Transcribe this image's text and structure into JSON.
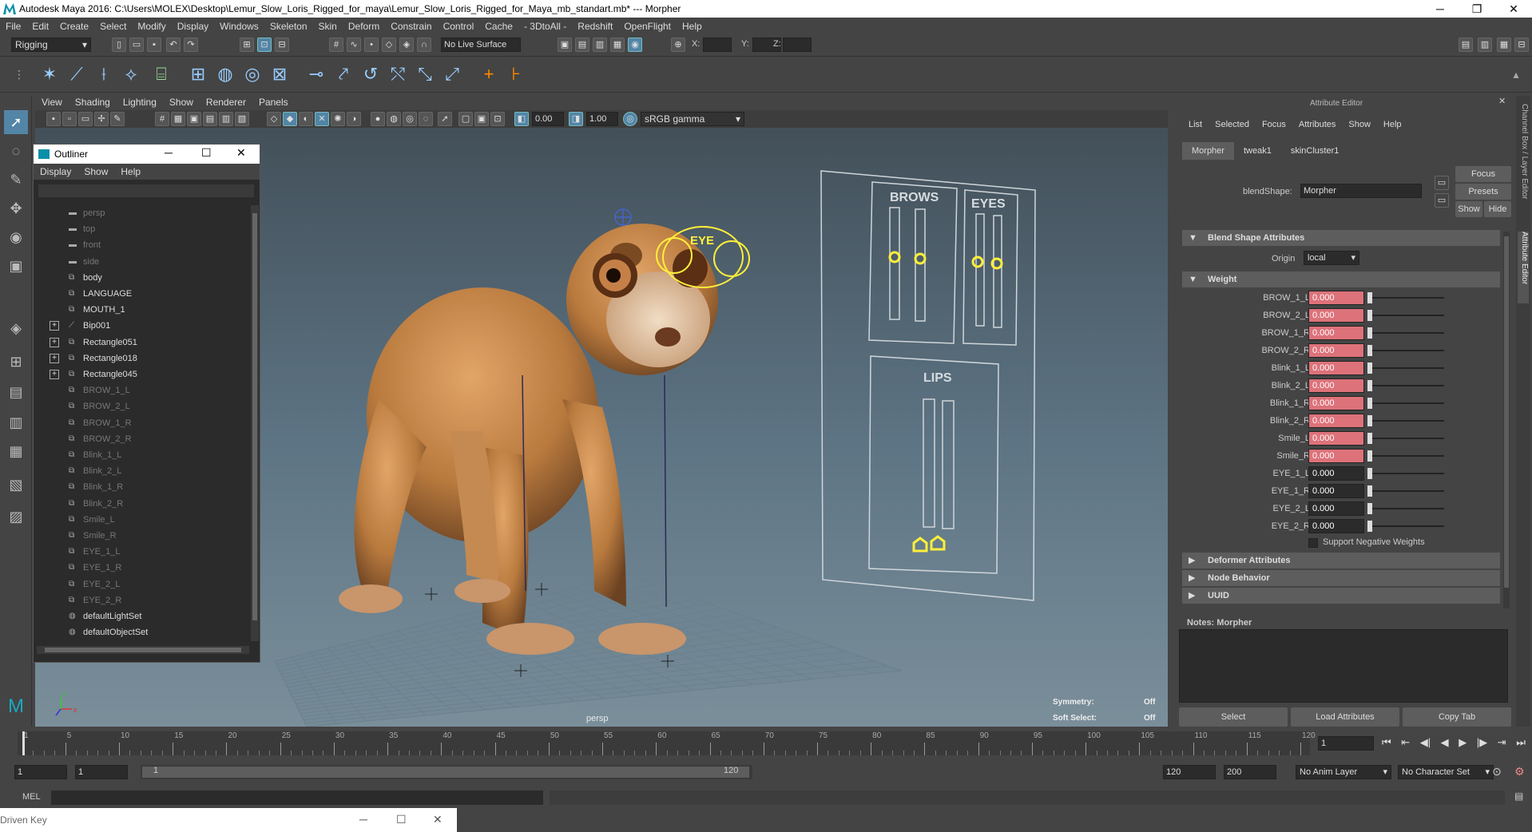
{
  "window": {
    "title": "Autodesk Maya 2016: C:\\Users\\MOLEX\\Desktop\\Lemur_Slow_Loris_Rigged_for_maya\\Lemur_Slow_Loris_Rigged_for_Maya_mb_standart.mb*   ---   Morpher",
    "controls": [
      "─",
      "❐",
      "✕"
    ]
  },
  "menubar": [
    "File",
    "Edit",
    "Create",
    "Select",
    "Modify",
    "Display",
    "Windows",
    "Skeleton",
    "Skin",
    "Deform",
    "Constrain",
    "Control",
    "Cache",
    "- 3DtoAll -",
    "Redshift",
    "OpenFlight",
    "Help"
  ],
  "statusline": {
    "menuset": "Rigging",
    "live_surface": "No Live Surface",
    "x_label": "X:",
    "y_label": "Y:",
    "z_label": "Z:"
  },
  "viewport": {
    "menus": [
      "View",
      "Shading",
      "Lighting",
      "Show",
      "Renderer",
      "Panels"
    ],
    "near_value": "0.00",
    "far_value": "1.00",
    "color_mgmt": "sRGB gamma",
    "camera_label": "persp",
    "symmetry_label": "Symmetry:",
    "symmetry_value": "Off",
    "soft_select_label": "Soft Select:",
    "soft_select_value": "Off",
    "panel_labels": {
      "brows": "BROWS",
      "eyes": "EYES",
      "lips": "LIPS",
      "eye_ctrl": "EYE"
    },
    "axis_x": "x",
    "axis_y": "y"
  },
  "outliner": {
    "title": "Outliner",
    "menus": [
      "Display",
      "Show",
      "Help"
    ],
    "items": [
      {
        "label": "persp",
        "kind": "camera",
        "expandable": false,
        "dim": true
      },
      {
        "label": "top",
        "kind": "camera",
        "expandable": false,
        "dim": true
      },
      {
        "label": "front",
        "kind": "camera",
        "expandable": false,
        "dim": true
      },
      {
        "label": "side",
        "kind": "camera",
        "expandable": false,
        "dim": true
      },
      {
        "label": "body",
        "kind": "mesh",
        "expandable": false,
        "dim": false
      },
      {
        "label": "LANGUAGE",
        "kind": "mesh",
        "expandable": false,
        "dim": false
      },
      {
        "label": "MOUTH_1",
        "kind": "mesh",
        "expandable": false,
        "dim": false
      },
      {
        "label": "Bip001",
        "kind": "joint",
        "expandable": true,
        "dim": false
      },
      {
        "label": "Rectangle051",
        "kind": "mesh",
        "expandable": true,
        "dim": false
      },
      {
        "label": "Rectangle018",
        "kind": "mesh",
        "expandable": true,
        "dim": false
      },
      {
        "label": "Rectangle045",
        "kind": "mesh",
        "expandable": true,
        "dim": false
      },
      {
        "label": "BROW_1_L",
        "kind": "mesh",
        "expandable": false,
        "dim": true
      },
      {
        "label": "BROW_2_L",
        "kind": "mesh",
        "expandable": false,
        "dim": true
      },
      {
        "label": "BROW_1_R",
        "kind": "mesh",
        "expandable": false,
        "dim": true
      },
      {
        "label": "BROW_2_R",
        "kind": "mesh",
        "expandable": false,
        "dim": true
      },
      {
        "label": "Blink_1_L",
        "kind": "mesh",
        "expandable": false,
        "dim": true
      },
      {
        "label": "Blink_2_L",
        "kind": "mesh",
        "expandable": false,
        "dim": true
      },
      {
        "label": "Blink_1_R",
        "kind": "mesh",
        "expandable": false,
        "dim": true
      },
      {
        "label": "Blink_2_R",
        "kind": "mesh",
        "expandable": false,
        "dim": true
      },
      {
        "label": "Smile_L",
        "kind": "mesh",
        "expandable": false,
        "dim": true
      },
      {
        "label": "Smile_R",
        "kind": "mesh",
        "expandable": false,
        "dim": true
      },
      {
        "label": "EYE_1_L",
        "kind": "mesh",
        "expandable": false,
        "dim": true
      },
      {
        "label": "EYE_1_R",
        "kind": "mesh",
        "expandable": false,
        "dim": true
      },
      {
        "label": "EYE_2_L",
        "kind": "mesh",
        "expandable": false,
        "dim": true
      },
      {
        "label": "EYE_2_R",
        "kind": "mesh",
        "expandable": false,
        "dim": true
      },
      {
        "label": "defaultLightSet",
        "kind": "set",
        "expandable": false,
        "dim": false
      },
      {
        "label": "defaultObjectSet",
        "kind": "set",
        "expandable": false,
        "dim": false
      }
    ]
  },
  "attribute_editor": {
    "title": "Attribute Editor",
    "menus": [
      "List",
      "Selected",
      "Focus",
      "Attributes",
      "Show",
      "Help"
    ],
    "tabs": [
      "Morpher",
      "tweak1",
      "skinCluster1"
    ],
    "node_type_label": "blendShape:",
    "node_name": "Morpher",
    "focus_btn": "Focus",
    "presets_btn": "Presets",
    "show_btn": "Show",
    "hide_btn": "Hide",
    "sections": {
      "blend": "Blend Shape Attributes",
      "weight": "Weight",
      "deformer": "Deformer Attributes",
      "node": "Node Behavior",
      "uuid": "UUID"
    },
    "origin_label": "Origin",
    "origin_value": "local",
    "weights": [
      {
        "name": "BROW_1_L",
        "value": "0.000",
        "keyed": true
      },
      {
        "name": "BROW_2_L",
        "value": "0.000",
        "keyed": true
      },
      {
        "name": "BROW_1_R",
        "value": "0.000",
        "keyed": true
      },
      {
        "name": "BROW_2_R",
        "value": "0.000",
        "keyed": true
      },
      {
        "name": "Blink_1_L",
        "value": "0.000",
        "keyed": true
      },
      {
        "name": "Blink_2_L",
        "value": "0.000",
        "keyed": true
      },
      {
        "name": "Blink_1_R",
        "value": "0.000",
        "keyed": true
      },
      {
        "name": "Blink_2_R",
        "value": "0.000",
        "keyed": true
      },
      {
        "name": "Smile_L",
        "value": "0.000",
        "keyed": true
      },
      {
        "name": "Smile_R",
        "value": "0.000",
        "keyed": true
      },
      {
        "name": "EYE_1_L",
        "value": "0.000",
        "keyed": false
      },
      {
        "name": "EYE_1_R",
        "value": "0.000",
        "keyed": false
      },
      {
        "name": "EYE_2_L",
        "value": "0.000",
        "keyed": false
      },
      {
        "name": "EYE_2_R",
        "value": "0.000",
        "keyed": false
      }
    ],
    "support_negative": "Support Negative Weights",
    "notes_label": "Notes:  Morpher",
    "bottom_buttons": [
      "Select",
      "Load Attributes",
      "Copy Tab"
    ],
    "side_tabs": [
      "Channel Box / Layer Editor",
      "Attribute Editor"
    ]
  },
  "timeslider": {
    "ticks": [
      "1",
      "5",
      "10",
      "15",
      "20",
      "25",
      "30",
      "35",
      "40",
      "45",
      "50",
      "55",
      "60",
      "65",
      "70",
      "75",
      "80",
      "85",
      "90",
      "95",
      "100",
      "105",
      "110",
      "115",
      "120"
    ],
    "current_frame": "1"
  },
  "range": {
    "start": "1",
    "anim_start": "1",
    "range_start": "1",
    "range_end": "120",
    "anim_end": "120",
    "end": "200",
    "anim_layer": "No Anim Layer",
    "char_set": "No Character Set"
  },
  "cmdline": {
    "lang": "MEL"
  },
  "driven_key": {
    "title": "Driven Key"
  }
}
